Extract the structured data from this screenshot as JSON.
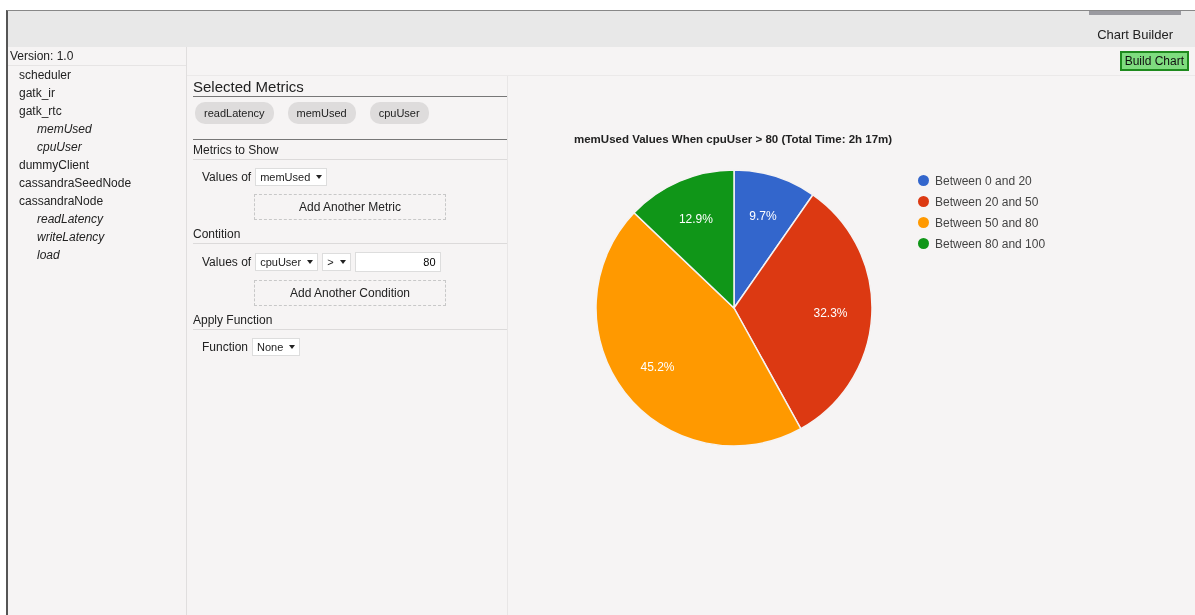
{
  "header": {
    "tabs": [
      {
        "label": "Chart Builder",
        "selected": true
      }
    ]
  },
  "sidebar": {
    "version": "Version: 1.0",
    "tree": [
      {
        "label": "scheduler"
      },
      {
        "label": "gatk_ir"
      },
      {
        "label": "gatk_rtc",
        "children": [
          {
            "label": "memUsed"
          },
          {
            "label": "cpuUser"
          }
        ]
      },
      {
        "label": "dummyClient"
      },
      {
        "label": "cassandraSeedNode"
      },
      {
        "label": "cassandraNode",
        "children": [
          {
            "label": "readLatency"
          },
          {
            "label": "writeLatency"
          },
          {
            "label": "load"
          }
        ]
      }
    ]
  },
  "toolbar": {
    "build_button": "Build Chart"
  },
  "form": {
    "selected_title": "Selected Metrics",
    "selected_metrics": [
      "readLatency",
      "memUsed",
      "cpuUser"
    ],
    "metrics_title": "Metrics to Show",
    "metric_label": "Values of",
    "metric_value": "memUsed",
    "add_metric": "Add Another Metric",
    "condition_title": "Contition",
    "condition_label": "Values of",
    "condition_metric": "cpuUser",
    "condition_operator": ">",
    "condition_value": "80",
    "add_condition": "Add Another Condition",
    "function_title": "Apply Function",
    "function_label": "Function",
    "function_value": "None"
  },
  "chart_data": {
    "type": "pie",
    "title": "memUsed Values When cpuUser > 80 (Total Time: 2h 17m)",
    "categories": [
      "Between 0 and 20",
      "Between 20 and 50",
      "Between 50 and 80",
      "Between 80 and 100"
    ],
    "colors": [
      "#3366cc",
      "#dc3912",
      "#ff9900",
      "#109618"
    ],
    "values": [
      9.7,
      32.3,
      45.2,
      12.9
    ],
    "legend": "right",
    "value_labels": [
      "9.7%",
      "32.3%",
      "45.2%",
      "12.9%"
    ]
  }
}
